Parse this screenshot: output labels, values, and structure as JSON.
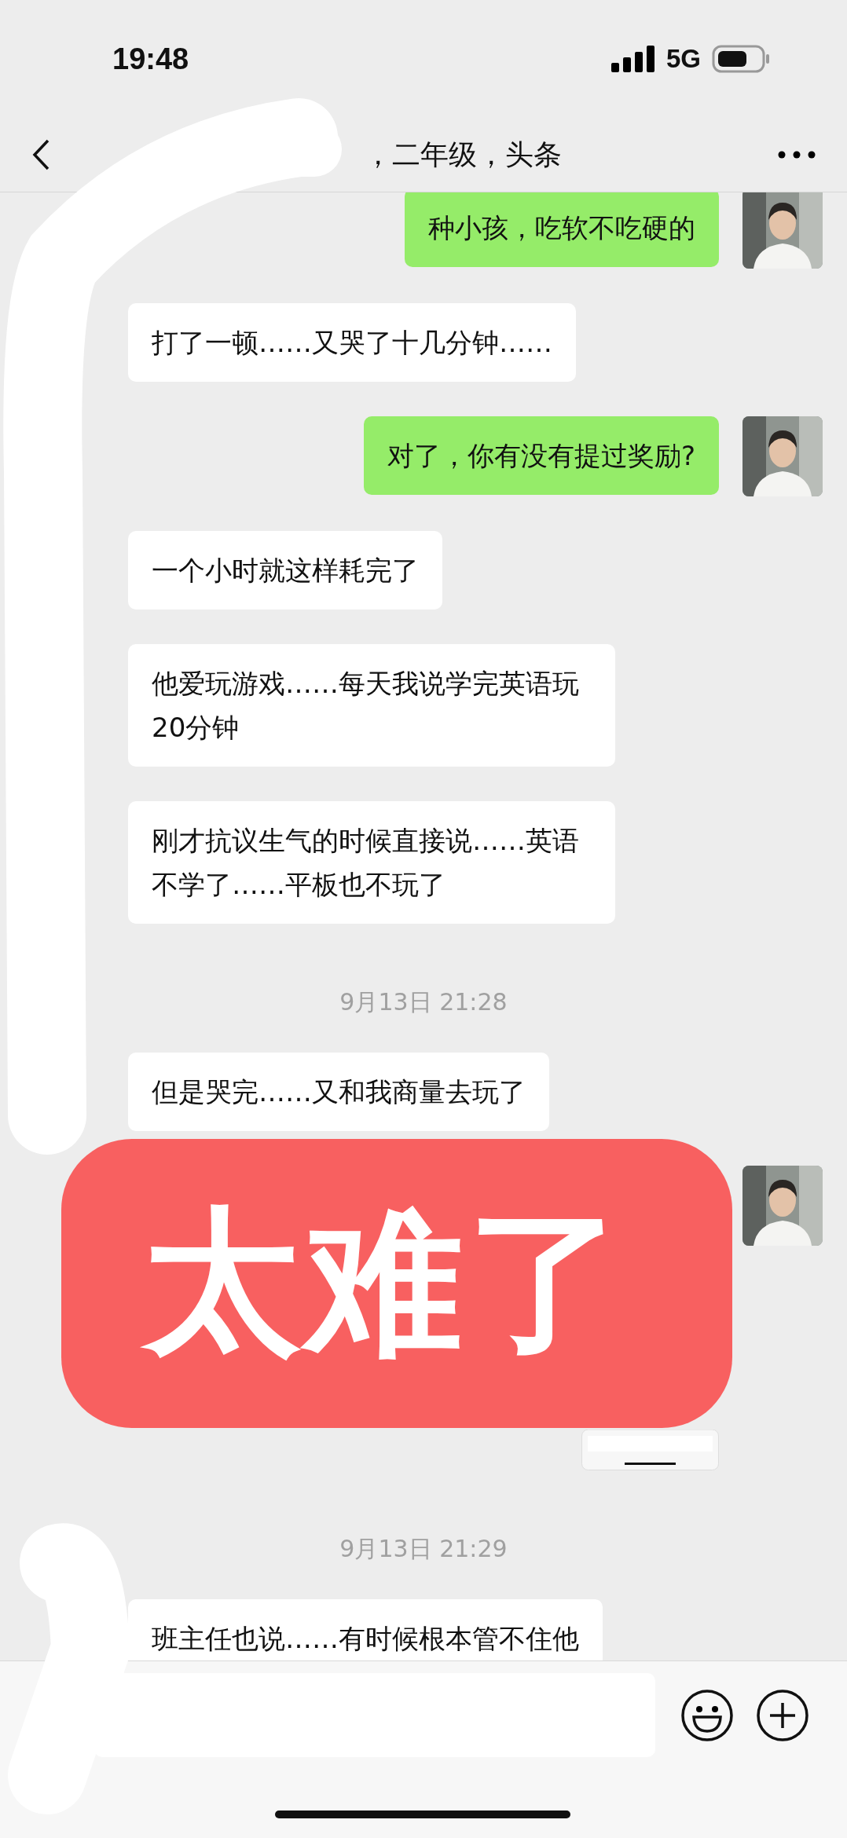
{
  "status_bar": {
    "time": "19:48",
    "network": "5G"
  },
  "nav": {
    "title": "，二年级，头条"
  },
  "messages": [
    {
      "kind": "outgoing_text",
      "text": "种小孩，吃软不吃硬的"
    },
    {
      "kind": "incoming_text",
      "text": "打了一顿……又哭了十几分钟……"
    },
    {
      "kind": "outgoing_text",
      "text": "对了，你有没有提过奖励?"
    },
    {
      "kind": "incoming_text",
      "text": "一个小时就这样耗完了"
    },
    {
      "kind": "incoming_text",
      "text": "他爱玩游戏……每天我说学完英语玩20分钟"
    },
    {
      "kind": "incoming_text",
      "text": "刚才抗议生气的时候直接说……英语不学了……平板也不玩了"
    },
    {
      "kind": "time",
      "text": "9月13日 21:28"
    },
    {
      "kind": "incoming_text",
      "text": "但是哭完……又和我商量去玩了"
    },
    {
      "kind": "outgoing_image"
    },
    {
      "kind": "time",
      "text": "9月13日 21:29"
    },
    {
      "kind": "incoming_text",
      "text": "班主任也说……有时候根本管不住他"
    }
  ],
  "sticker": {
    "text": "太难了"
  }
}
